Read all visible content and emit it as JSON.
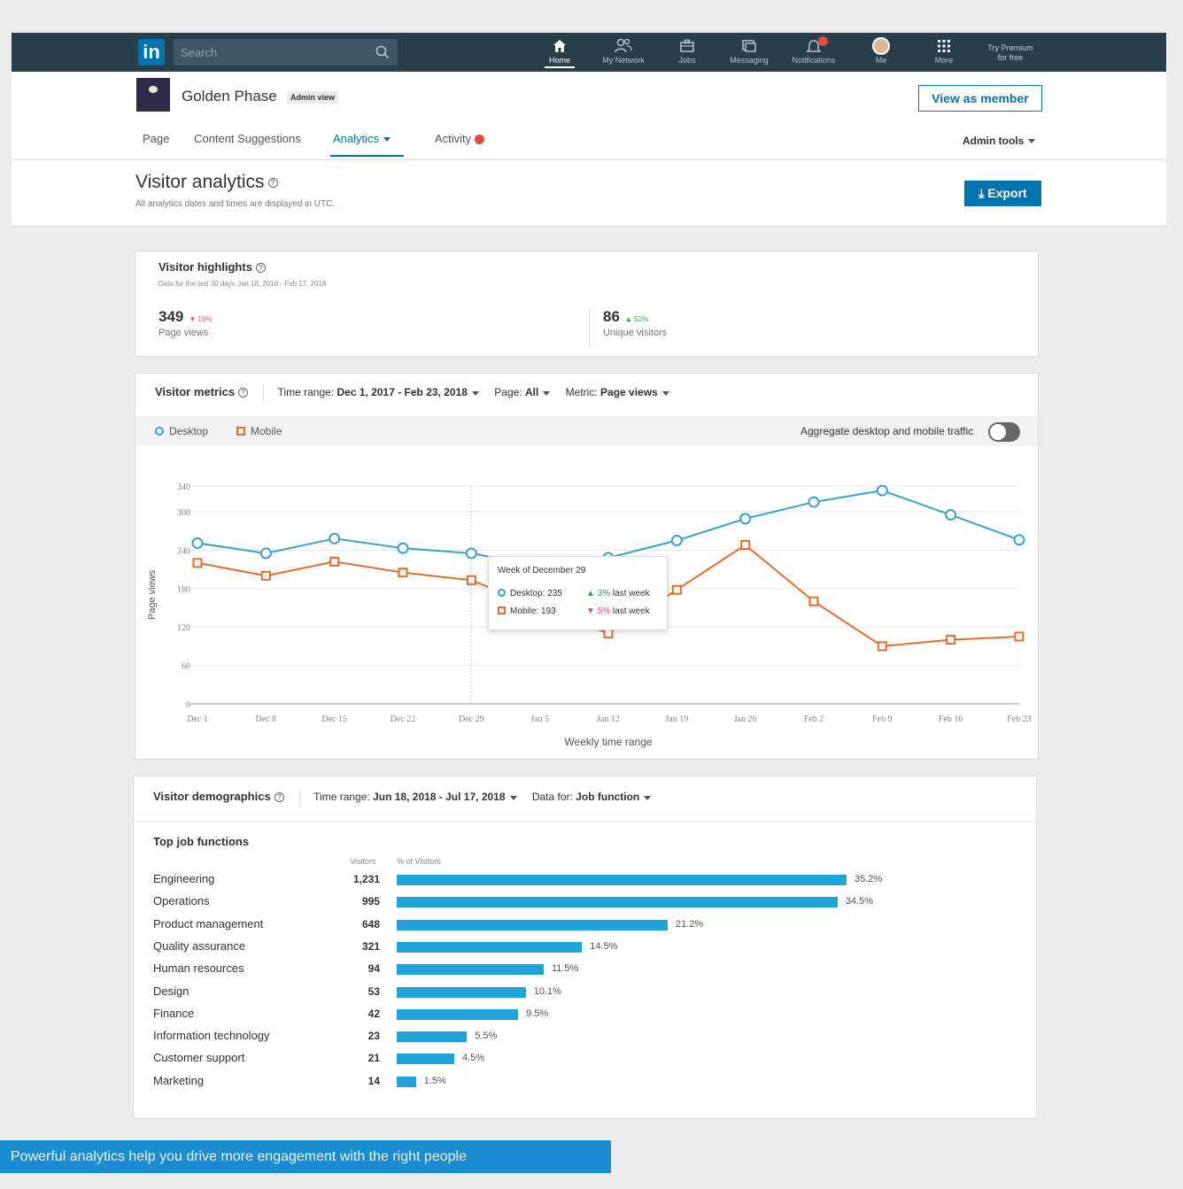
{
  "nav": {
    "logo": "in",
    "search_placeholder": "Search",
    "items": [
      {
        "label": "Home",
        "icon": "home-icon"
      },
      {
        "label": "My Network",
        "icon": "network-icon"
      },
      {
        "label": "Jobs",
        "icon": "briefcase-icon"
      },
      {
        "label": "Messaging",
        "icon": "messaging-icon"
      },
      {
        "label": "Notifications",
        "icon": "bell-icon"
      },
      {
        "label": "Me",
        "icon": "avatar"
      },
      {
        "label": "More",
        "icon": "grid-icon"
      }
    ],
    "premium_line1": "Try Premium",
    "premium_line2": "for free"
  },
  "header": {
    "company_name": "Golden Phase",
    "admin_badge": "Admin view",
    "view_as_member": "View as member",
    "tabs": [
      "Page",
      "Content Suggestions",
      "Analytics",
      "Activity"
    ],
    "admin_tools": "Admin tools",
    "page_title": "Visitor analytics",
    "page_subtitle": "All analytics dates and times are displayed in UTC.",
    "export_label": "Export"
  },
  "highlights": {
    "title": "Visitor highlights",
    "subtitle": "Data for the last 30 days Jan 18, 2018 - Feb 17, 2018",
    "page_views": {
      "value": "349",
      "change": "16%",
      "label": "Page views"
    },
    "unique_visitors": {
      "value": "86",
      "change": "51%",
      "label": "Unique visitors"
    }
  },
  "metrics": {
    "title": "Visitor metrics",
    "time_range_label": "Time range:",
    "time_range_value": "Dec 1, 2017 - Feb 23, 2018",
    "page_label": "Page:",
    "page_value": "All",
    "metric_label": "Metric:",
    "metric_value": "Page views",
    "legend_desktop": "Desktop",
    "legend_mobile": "Mobile",
    "aggregate_label": "Aggregate desktop and mobile traffic",
    "tooltip": {
      "title": "Week of December 29",
      "desktop": "Desktop: 235",
      "desktop_change": "3%",
      "mobile": "Mobile: 193",
      "mobile_change": "5%",
      "suffix": "last week"
    }
  },
  "colors": {
    "accent": "#0073b1",
    "desktop": "#35a3d0",
    "mobile": "#ea6a2a",
    "bar": "#1fa3d9"
  },
  "chart_data": {
    "type": "line",
    "x": [
      "Dec 1",
      "Dec 8",
      "Dec 15",
      "Dec 22",
      "Dec 29",
      "Jan 5",
      "Jan 12",
      "Jan 19",
      "Jan 26",
      "Feb 2",
      "Feb 9",
      "Feb 16",
      "Feb 23"
    ],
    "series": [
      {
        "name": "Desktop",
        "values": [
          251,
          235,
          258,
          243,
          235,
          215,
          228,
          255,
          289,
          315,
          333,
          295,
          256
        ]
      },
      {
        "name": "Mobile",
        "values": [
          220,
          200,
          222,
          205,
          193,
          150,
          110,
          178,
          248,
          160,
          90,
          100,
          105
        ]
      }
    ],
    "xlabel": "Weekly time range",
    "ylabel": "Page views",
    "yticks": [
      0,
      60,
      120,
      180,
      240,
      300,
      340
    ],
    "ylim": [
      0,
      340
    ],
    "grid": true
  },
  "demographics": {
    "title": "Visitor demographics",
    "time_range_label": "Time range:",
    "time_range_value": "Jun 18, 2018 - Jul 17, 2018",
    "data_for_label": "Data for:",
    "data_for_value": "Job function",
    "subtitle": "Top job functions",
    "col_visitors": "Visitors",
    "col_pct": "% of Visitors",
    "rows": [
      {
        "label": "Engineering",
        "count": "1,231",
        "pct": 35.2,
        "pct_label": "35.2%"
      },
      {
        "label": "Operations",
        "count": "995",
        "pct": 34.5,
        "pct_label": "34.5%"
      },
      {
        "label": "Product management",
        "count": "648",
        "pct": 21.2,
        "pct_label": "21.2%"
      },
      {
        "label": "Quality assurance",
        "count": "321",
        "pct": 14.5,
        "pct_label": "14.5%"
      },
      {
        "label": "Human resources",
        "count": "94",
        "pct": 11.5,
        "pct_label": "11.5%"
      },
      {
        "label": "Design",
        "count": "53",
        "pct": 10.1,
        "pct_label": "10.1%"
      },
      {
        "label": "Finance",
        "count": "42",
        "pct": 9.5,
        "pct_label": "9.5%"
      },
      {
        "label": "Information technology",
        "count": "23",
        "pct": 5.5,
        "pct_label": "5.5%"
      },
      {
        "label": "Customer support",
        "count": "21",
        "pct": 4.5,
        "pct_label": "4.5%"
      },
      {
        "label": "Marketing",
        "count": "14",
        "pct": 1.5,
        "pct_label": "1.5%"
      }
    ]
  },
  "caption": "Powerful analytics help you drive more engagement with the right people"
}
